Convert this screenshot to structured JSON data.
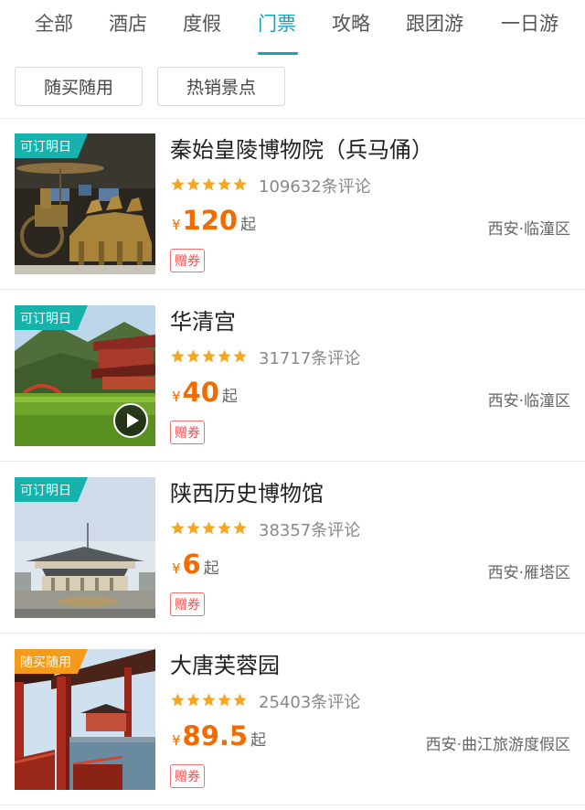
{
  "tabs": [
    {
      "label": "全部",
      "active": false
    },
    {
      "label": "酒店",
      "active": false
    },
    {
      "label": "度假",
      "active": false
    },
    {
      "label": "门票",
      "active": true
    },
    {
      "label": "攻略",
      "active": false
    },
    {
      "label": "跟团游",
      "active": false
    },
    {
      "label": "一日游",
      "active": false
    }
  ],
  "filters": [
    "随买随用",
    "热销景点"
  ],
  "colors": {
    "accent": "#1aa0b8",
    "price": "#f06b00",
    "star": "#f5a623",
    "tag_teal": "#18b2ad",
    "tag_orange": "#f59b1b",
    "coupon": "#f05050"
  },
  "items": [
    {
      "tag": "可订明日",
      "tag_color": "teal",
      "title": "秦始皇陵博物院（兵马俑）",
      "rating": 5,
      "reviews": "109632条评论",
      "currency": "¥",
      "price": "120",
      "price_suffix": "起",
      "location": "西安·临潼区",
      "badge": "赠券",
      "has_video": false,
      "image": "terracotta-warriors-bronze-chariot"
    },
    {
      "tag": "可订明日",
      "tag_color": "teal",
      "title": "华清宫",
      "rating": 5,
      "reviews": "31717条评论",
      "currency": "¥",
      "price": "40",
      "price_suffix": "起",
      "location": "西安·临潼区",
      "badge": "赠券",
      "has_video": true,
      "image": "huaqing-palace-pavilion-green-pond"
    },
    {
      "tag": "可订明日",
      "tag_color": "teal",
      "title": "陕西历史博物馆",
      "rating": 5,
      "reviews": "38357条评论",
      "currency": "¥",
      "price": "6",
      "price_suffix": "起",
      "location": "西安·雁塔区",
      "badge": "赠券",
      "has_video": false,
      "image": "shaanxi-history-museum-building"
    },
    {
      "tag": "随买随用",
      "tag_color": "orange",
      "title": "大唐芙蓉园",
      "rating": 5,
      "reviews": "25403条评论",
      "currency": "¥",
      "price": "89.5",
      "price_suffix": "起",
      "location": "西安·曲江旅游度假区",
      "badge": "赠券",
      "has_video": false,
      "image": "tang-paradise-red-corridor-lake"
    }
  ]
}
